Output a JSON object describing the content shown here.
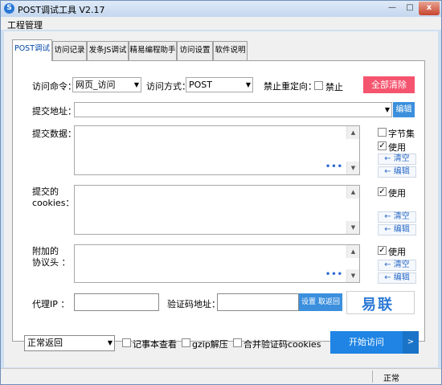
{
  "window": {
    "title": "POST调试工具 V2.17",
    "app_icon": "S"
  },
  "menu": {
    "items": [
      "工程管理"
    ]
  },
  "tabs": [
    {
      "label": "POST调试",
      "active": true
    },
    {
      "label": "访问记录"
    },
    {
      "label": "发条JS调试"
    },
    {
      "label": "精易编程助手"
    },
    {
      "label": "访问设置"
    },
    {
      "label": "软件说明"
    }
  ],
  "form": {
    "access_cmd_label": "访问命令：",
    "access_cmd_value": "网页_访问",
    "access_method_label": "访问方式：",
    "access_method_value": "POST",
    "no_redirect_label": "禁止重定向：",
    "no_redirect_check_label": "禁止",
    "clear_all": "全部清除",
    "submit_url_label": "提交地址：",
    "edit": "编辑",
    "submit_data_label": "提交数据：",
    "byte_set": "字节集",
    "use": "使用",
    "clear_btn": "← 清空",
    "edit_btn": "← 编辑",
    "cookies_label_1": "提交的",
    "cookies_label_2": "cookies：",
    "headers_label_1": "附加的",
    "headers_label_2": "协议头  ：",
    "dots": "•••",
    "proxy_label": "代理IP  ：",
    "captcha_label": "验证码地址：",
    "set_btn": "设置",
    "cancel_return_btn": "取返回",
    "logo_text": "易联"
  },
  "bottom": {
    "return_mode": "正常返回",
    "notepad_view": "记事本查看",
    "gzip": "gzip解压",
    "merge_cookies": "合并验证码cookies",
    "start": "开始访问",
    "start_arrow": ">"
  },
  "status": {
    "text": "正常"
  },
  "icons": {
    "minimize": "—",
    "maximize": "□",
    "close": "x",
    "dropdown": "▼",
    "scroll_up": "▲",
    "scroll_down": "▼",
    "checkmark": "✓"
  }
}
